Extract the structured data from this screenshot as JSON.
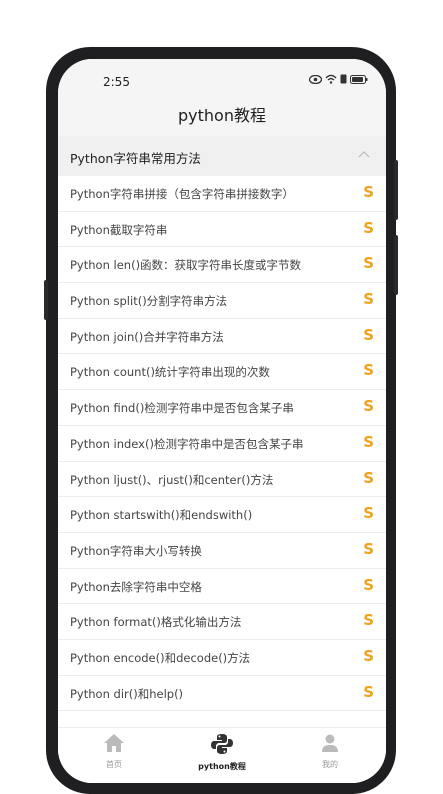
{
  "status": {
    "time": "2:55"
  },
  "header": {
    "title": "python教程"
  },
  "section": {
    "title": "Python字符串常用方法"
  },
  "items": [
    {
      "label": "Python字符串拼接（包含字符串拼接数字）",
      "badge": "S"
    },
    {
      "label": "Python截取字符串",
      "badge": "S"
    },
    {
      "label": "Python len()函数：获取字符串长度或字节数",
      "badge": "S"
    },
    {
      "label": "Python split()分割字符串方法",
      "badge": "S"
    },
    {
      "label": "Python join()合并字符串方法",
      "badge": "S"
    },
    {
      "label": "Python count()统计字符串出现的次数",
      "badge": "S"
    },
    {
      "label": "Python find()检测字符串中是否包含某子串",
      "badge": "S"
    },
    {
      "label": "Python index()检测字符串中是否包含某子串",
      "badge": "S"
    },
    {
      "label": "Python ljust()、rjust()和center()方法",
      "badge": "S"
    },
    {
      "label": "Python startswith()和endswith()",
      "badge": "S"
    },
    {
      "label": "Python字符串大小写转换",
      "badge": "S"
    },
    {
      "label": "Python去除字符串中空格",
      "badge": "S"
    },
    {
      "label": "Python format()格式化输出方法",
      "badge": "S"
    },
    {
      "label": "Python encode()和decode()方法",
      "badge": "S"
    },
    {
      "label": "Python dir()和help()",
      "badge": "S"
    }
  ],
  "tabs": [
    {
      "label": "首页",
      "icon": "home-icon"
    },
    {
      "label": "python教程",
      "icon": "python-logo-icon"
    },
    {
      "label": "我的",
      "icon": "user-icon"
    }
  ],
  "colors": {
    "accent": "#f0a21c",
    "tab_inactive": "#bbbbbb"
  }
}
